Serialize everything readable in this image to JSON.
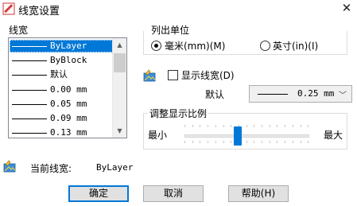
{
  "window": {
    "title": "线宽设置",
    "close_glyph": "✕"
  },
  "lineweight_list": {
    "group_label": "线宽",
    "items": [
      {
        "label": "ByLayer",
        "selected": true
      },
      {
        "label": "ByBlock"
      },
      {
        "label": "默认"
      },
      {
        "label": "0.00 mm"
      },
      {
        "label": "0.05 mm"
      },
      {
        "label": "0.09 mm"
      },
      {
        "label": "0.13 mm"
      }
    ],
    "scroll_up_glyph": "▲",
    "scroll_down_glyph": "▼"
  },
  "units": {
    "group_label": "列出单位",
    "options": [
      {
        "label": "毫米(mm)(M)",
        "selected": true
      },
      {
        "label": "英寸(in)(I)",
        "selected": false
      }
    ]
  },
  "display": {
    "checkbox_label": "显示线宽(D)",
    "checked": false,
    "default_label": "默认",
    "default_value": "0.25 mm",
    "dropdown_glyph": "﹀"
  },
  "scale": {
    "group_label": "调整显示比例",
    "min_label": "最小",
    "max_label": "最大",
    "level_fraction": 0.42
  },
  "current": {
    "label": "当前线宽:",
    "value": "ByLayer"
  },
  "buttons": {
    "ok": "确定",
    "cancel": "取消",
    "help": "帮助(H)"
  },
  "colors": {
    "selection": "#0078d7",
    "slider_thumb": "#0078d7",
    "default_button_border": "#0078d7"
  },
  "icons": [
    "lineweight-app-icon",
    "close-icon",
    "paint-palette-icon"
  ]
}
